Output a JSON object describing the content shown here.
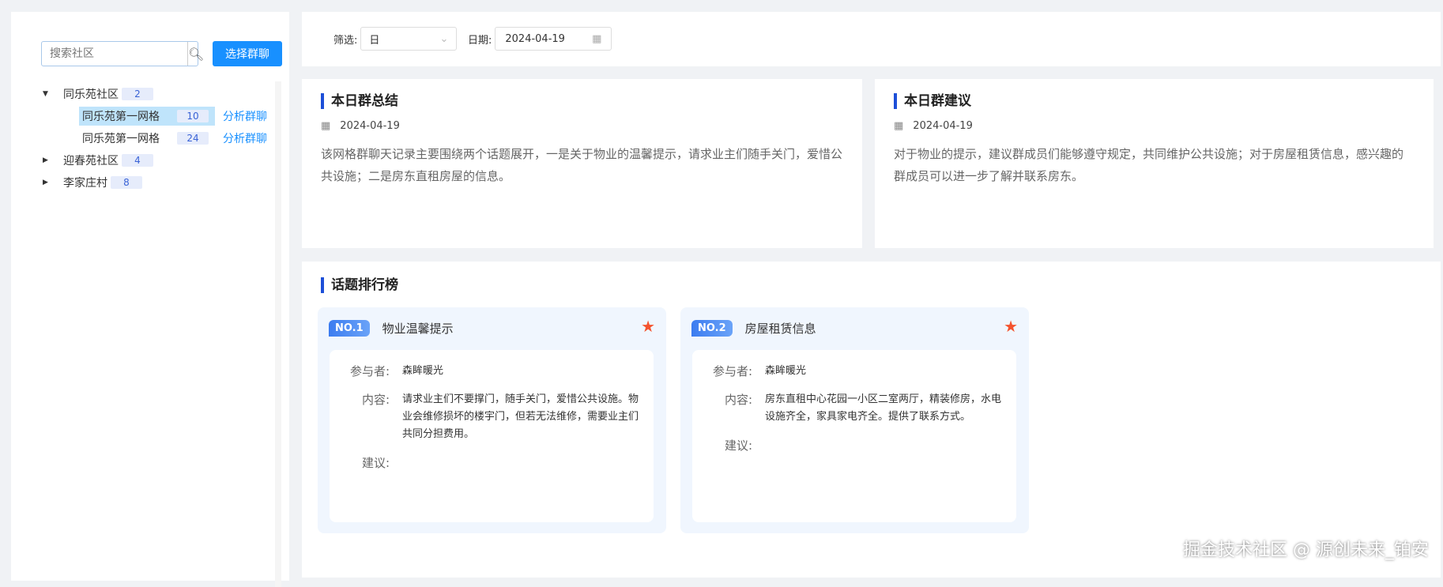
{
  "sidebar": {
    "search_placeholder": "搜索社区",
    "select_button": "选择群聊",
    "tree": [
      {
        "name": "同乐苑社区",
        "count": "2",
        "children": [
          {
            "name": "同乐苑第一网格",
            "count": "10",
            "action": "分析群聊"
          },
          {
            "name": "同乐苑第一网格",
            "count": "24",
            "action": "分析群聊"
          }
        ]
      },
      {
        "name": "迎春苑社区",
        "count": "4"
      },
      {
        "name": "李家庄村",
        "count": "8"
      }
    ]
  },
  "filter": {
    "filter_label": "筛选:",
    "filter_value": "日",
    "date_label": "日期:",
    "date_value": "2024-04-19"
  },
  "summary": {
    "title": "本日群总结",
    "date": "2024-04-19",
    "text": "该网格群聊天记录主要围绕两个话题展开，一是关于物业的温馨提示，请求业主们随手关门，爱惜公共设施；二是房东直租房屋的信息。"
  },
  "advice": {
    "title": "本日群建议",
    "date": "2024-04-19",
    "text": "对于物业的提示，建议群成员们能够遵守规定，共同维护公共设施；对于房屋租赁信息，感兴趣的群成员可以进一步了解并联系房东。"
  },
  "topics": {
    "title": "话题排行榜",
    "labels": {
      "participants": "参与者:",
      "content": "内容:",
      "suggestion": "建议:"
    },
    "items": [
      {
        "rank": "NO.1",
        "name": "物业温馨提示",
        "participants": "森眸暖光",
        "content": "请求业主们不要撑门，随手关门，爱惜公共设施。物业会维修损坏的楼宇门，但若无法维修，需要业主们共同分担费用。",
        "suggestion": ""
      },
      {
        "rank": "NO.2",
        "name": "房屋租赁信息",
        "participants": "森眸暖光",
        "content": "房东直租中心花园一小区二室两厅，精装修房，水电设施齐全，家具家电齐全。提供了联系方式。",
        "suggestion": ""
      }
    ]
  },
  "watermark": "掘金技术社区 @ 源创未来_铂安"
}
